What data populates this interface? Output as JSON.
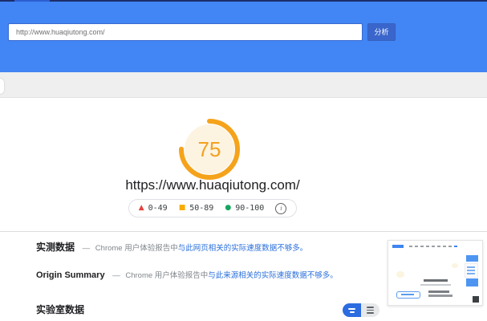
{
  "colors": {
    "header_blue": "#4285f4",
    "analyze_button_blue": "#3a66cc",
    "link_blue": "#2a6fdb",
    "score_orange": "#f2a11e",
    "gauge_ring_orange": "#f5a31b",
    "gauge_fill_cream": "#fdf3e1",
    "fail_red": "#e4423b",
    "average_orange": "#f9ab00",
    "pass_green": "#13a75f",
    "toggle_active_blue": "#2b6ce0"
  },
  "header": {
    "url_input_value": "http://www.huaqiutong.com/",
    "analyze_button_label": "分析"
  },
  "report": {
    "score": "75",
    "page_url": "https://www.huaqiutong.com/",
    "legend": {
      "fail_icon": "▲",
      "fail_label": "0-49",
      "average_icon": "■",
      "average_label": "50-89",
      "pass_icon": "●",
      "pass_label": "90-100",
      "info_glyph": "i"
    },
    "sections": {
      "field_data": {
        "title": "实测数据",
        "separator": "—",
        "description": "Chrome 用户体验报告中",
        "link_text": "与此网页相关的实际速度数据不够多。"
      },
      "origin_summary": {
        "title": "Origin Summary",
        "separator": "—",
        "description": "Chrome 用户体验报告中",
        "link_text": "与此来源相关的实际速度数据不够多。"
      },
      "lab_data": {
        "title": "实验室数据"
      }
    }
  }
}
